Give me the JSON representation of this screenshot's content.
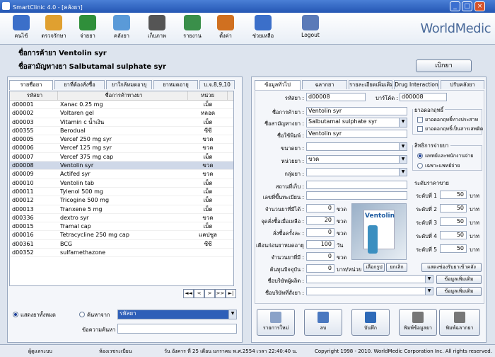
{
  "window": {
    "title": "SmartClinic 4.0 - [คลังยา]"
  },
  "toolbar": {
    "items": [
      {
        "label": "คนไข้",
        "icon": "patient-icon",
        "color": "#3b6fc9"
      },
      {
        "label": "ตรวจรักษา",
        "icon": "doctor-icon",
        "color": "#e0a030"
      },
      {
        "label": "จ่ายยา",
        "icon": "dispense-icon",
        "color": "#2f8f3a"
      },
      {
        "label": "คลังยา",
        "icon": "pill-icon",
        "color": "#5a9ad8"
      },
      {
        "label": "เก็บภาพ",
        "icon": "camera-icon",
        "color": "#555555"
      },
      {
        "label": "รายงาน",
        "icon": "report-chart-icon",
        "color": "#3a8f4a"
      },
      {
        "label": "ตั้งค่า",
        "icon": "settings-icon",
        "color": "#d07020"
      },
      {
        "label": "ช่วยเหลือ",
        "icon": "help-icon",
        "color": "#3b6fc9"
      },
      {
        "label": "Logout",
        "icon": "logout-icon",
        "color": "#5a7ab8"
      }
    ],
    "brand": "WorldMedic"
  },
  "header": {
    "trade_name": "ชื่อการค้ายา  Ventolin syr",
    "generic_name": "ชื่อสามัญทางยา  Salbutamal sulphate syr",
    "open_button": "เบิกยา"
  },
  "left": {
    "tabs": [
      "รายชื่อยา",
      "ยาที่ต้องสั่งซื้อ",
      "ยาใกล้หมดอายุ",
      "ยาหมดอายุ",
      "บ.จ.8,9,10"
    ],
    "columns": [
      "รหัสยา",
      "ชื่อการค้าทางยา",
      "หน่วย"
    ],
    "rows": [
      [
        "d00001",
        "Xanac 0.25 mg",
        "เม็ด"
      ],
      [
        "d00002",
        "Voltaren gel",
        "หลอด"
      ],
      [
        "d00003",
        "Vitamin c น้ำเงิน",
        "เม็ด"
      ],
      [
        "d00355",
        "Berodual",
        "ซีซี"
      ],
      [
        "d00005",
        "Vercef 250 mg syr",
        "ขวด"
      ],
      [
        "d00006",
        "Vercef 125 mg syr",
        "ขวด"
      ],
      [
        "d00007",
        "Vercef 375 mg cap",
        "เม็ด"
      ],
      [
        "d00008",
        "Ventolin syr",
        "ขวด"
      ],
      [
        "d00009",
        "Actifed syr",
        "ขวด"
      ],
      [
        "d00010",
        "Ventolin tab",
        "เม็ด"
      ],
      [
        "d00011",
        "Tylenol 500 mg",
        "เม็ด"
      ],
      [
        "d00012",
        "Tricogine 500 mg",
        "เม็ด"
      ],
      [
        "d00013",
        "Tranxene 5 mg",
        "เม็ด"
      ],
      [
        "d00336",
        "dextro syr",
        "ขวด"
      ],
      [
        "d00015",
        "Tramal cap",
        "เม็ด"
      ],
      [
        "d00016",
        "Tetracycline 250 mg cap",
        "แคปซูล"
      ],
      [
        "d00361",
        "BCG",
        "ซีซี"
      ],
      [
        "d00352",
        "sulfamethazone",
        ""
      ]
    ],
    "selected_index": 7,
    "nav": [
      "|◄",
      "◄◄",
      "<",
      ">",
      ">>",
      "►|"
    ],
    "show_all": "แสดงยาทั้งหมด",
    "search_by": "ค้นหาจาก",
    "search_field": "รหัสยา",
    "search_label": "ข้อความค้นหา"
  },
  "right": {
    "tabs": [
      "ข้อมูลทั่วไป",
      "ฉลากยา",
      "รายละเอียดเพิ่มเติม",
      "Drug Interaction",
      "ปรับคลังยา"
    ],
    "code_label": "รหัสยา :",
    "code": "d00008",
    "barcode_label": "บาร์โค้ด :",
    "barcode": "d00008",
    "trade_label": "ชื่อการค้ายา :",
    "trade": "Ventolin syr",
    "generic_label": "ชื่อสามัญทางยา :",
    "generic": "Salbutamal sulphate syr",
    "print_label": "ชื่อใช้พิมพ์ :",
    "print": "Ventolin syr",
    "size_label": "ขนาดยา :",
    "unit_label": "หน่วยยา :",
    "unit": "ขวด",
    "group_label": "กลุ่มยา :",
    "place_label": "สถานที่เก็บ :",
    "reg_label": "เลขที่ขึ้นทะเบียน :",
    "remain_label": "จำนวนยาที่มีได้ :",
    "remain": "0",
    "remain_unit": "ขวด",
    "reorder_label": "จุดสั่งซื้อเมื่อเหลือ :",
    "reorder": "20",
    "reorder_unit": "ขวด",
    "order_label": "สั่งซื้อครั้งละ :",
    "order": "0",
    "order_unit": "ขวด",
    "warn_label": "เตือนก่อนยาหมดอายุ :",
    "warn": "100",
    "warn_unit": "วัน",
    "count_label": "จำนวนยาที่มี :",
    "count": "0",
    "count_unit": "ขวด",
    "cost_label": "ต้นทุนปัจจุบัน :",
    "cost": "0",
    "cost_unit": "บาท/หน่วย",
    "choose_pic": "เลือกรูป",
    "cancel_pic": "ยกเลิก",
    "drug_type_title": "ยาอดอกฤทธิ์",
    "drug_type_opts": [
      "ยาอดอกฤทธิ์ทางประสาท",
      "ยาอดอกฤทธิ์เป็นสารเสพติด"
    ],
    "right_title": "สิทธิการจ่ายยา",
    "right_opts": [
      "แพทย์และพนักงานจ่าย",
      "เฉพาะแพทย์จ่าย"
    ],
    "price_title": "ระดับราคาขาย",
    "levels": [
      {
        "label": "ระดับที่ 1",
        "value": "50",
        "unit": "บาท"
      },
      {
        "label": "ระดับที่ 2",
        "value": "50",
        "unit": "บาท"
      },
      {
        "label": "ระดับที่ 3",
        "value": "50",
        "unit": "บาท"
      },
      {
        "label": "ระดับที่ 4",
        "value": "50",
        "unit": "บาท"
      },
      {
        "label": "ระดับที่ 5",
        "value": "50",
        "unit": "บาท"
      }
    ],
    "show_sellers": "แสดงช่องรับยาเข้าคลัง",
    "maker_label": "ชื่อบริษัทผู้ผลิต :",
    "seller_label": "ชื่อบริษัทที่สั่งยา :",
    "more": "ข้อมูลเพิ่มเติม",
    "product_image_text": "Ventolin",
    "actions": [
      "รายการใหม่",
      "ลบ",
      "บันทึก",
      "พิมพ์ข้อมูลยา",
      "พิมพ์ฉลากยา"
    ]
  },
  "status": {
    "user": "ผู้ดูแลระบบ",
    "role": "ห้องเวชระเบียน",
    "datetime": "วัน อังคาร ที่ 25 เดือน มกราคม พ.ศ.2554 เวลา 22:40:40 น.",
    "copyright": "Copyright 1998 - 2010. WorldMedic Corporation Inc. All rights reserved."
  }
}
